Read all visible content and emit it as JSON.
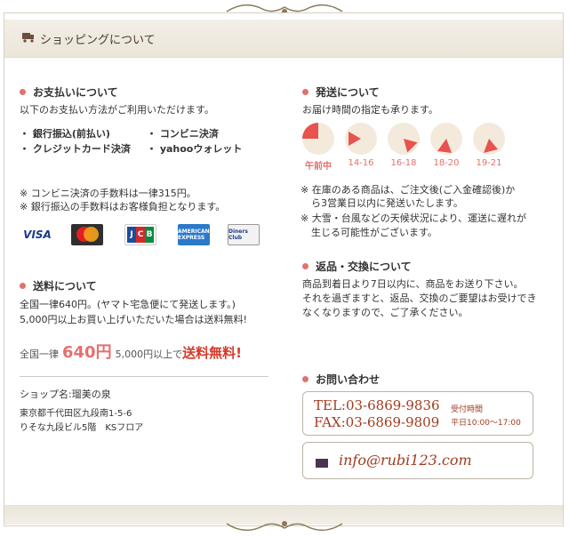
{
  "header": {
    "title": "ショッピングについて",
    "icon": "truck-icon"
  },
  "payment": {
    "heading": "お支払いについて",
    "intro": "以下のお支払い方法がご利用いただけます。",
    "methods": [
      "・ 銀行振込(前払い)",
      "・ コンビニ決済",
      "・ クレジットカード決済",
      "・ yahooウォレット"
    ],
    "notes": [
      "※ コンビニ決済の手数料は一律315円。",
      "※ 銀行振込の手数料はお客様負担となります。"
    ],
    "cards": {
      "visa": "VISA",
      "master": "MasterCard",
      "jcb": [
        "J",
        "C",
        "B"
      ],
      "amex": "AMERICAN EXPRESS",
      "diners": "Diners Club"
    }
  },
  "shipping_fee": {
    "heading": "送料について",
    "line1": "全国一律640円。(ヤマト宅急便にて発送します。)",
    "line2": "5,000円以上お買い上げいただいた場合は送料無料!",
    "banner_prefix": "全国一律",
    "banner_price": "640円",
    "banner_mid": "5,000円以上で",
    "banner_free": "送料無料!"
  },
  "shop": {
    "name": "ショップ名:瑠美の泉",
    "address1": "東京都千代田区九段南1-5-6",
    "address2": "りそな九段ビル5階　KSフロア"
  },
  "delivery": {
    "heading": "発送について",
    "intro": "お届け時間の指定も承ります。",
    "slots": [
      "午前中",
      "14-16",
      "16-18",
      "18-20",
      "19-21"
    ],
    "notes": [
      "※ 在庫のある商品は、ご注文後(ご入金確認後)か",
      "ら3営業日以内に発送いたします。",
      "※ 大雪・台風などの天候状況により、運送に遅れが",
      "生じる可能性がございます。"
    ]
  },
  "returns": {
    "heading": "返品・交換について",
    "lines": [
      "商品到着日より7日以内に、商品をお送り下さい。",
      "それを過ぎますと、返品、交換のご要望はお受けでき",
      "なくなりますので、ご了承ください。"
    ]
  },
  "contact": {
    "heading": "お問い合わせ",
    "tel": "TEL:03-6869-9836",
    "fax": "FAX:03-6869-9809",
    "hours_label": "受付時間",
    "hours": "平日10:00～17:00",
    "email": "info@rubi123.com"
  },
  "colors": {
    "accent": "#e2716f",
    "header_bg": "#f0ebe2",
    "contact_text": "#a13c1f"
  }
}
